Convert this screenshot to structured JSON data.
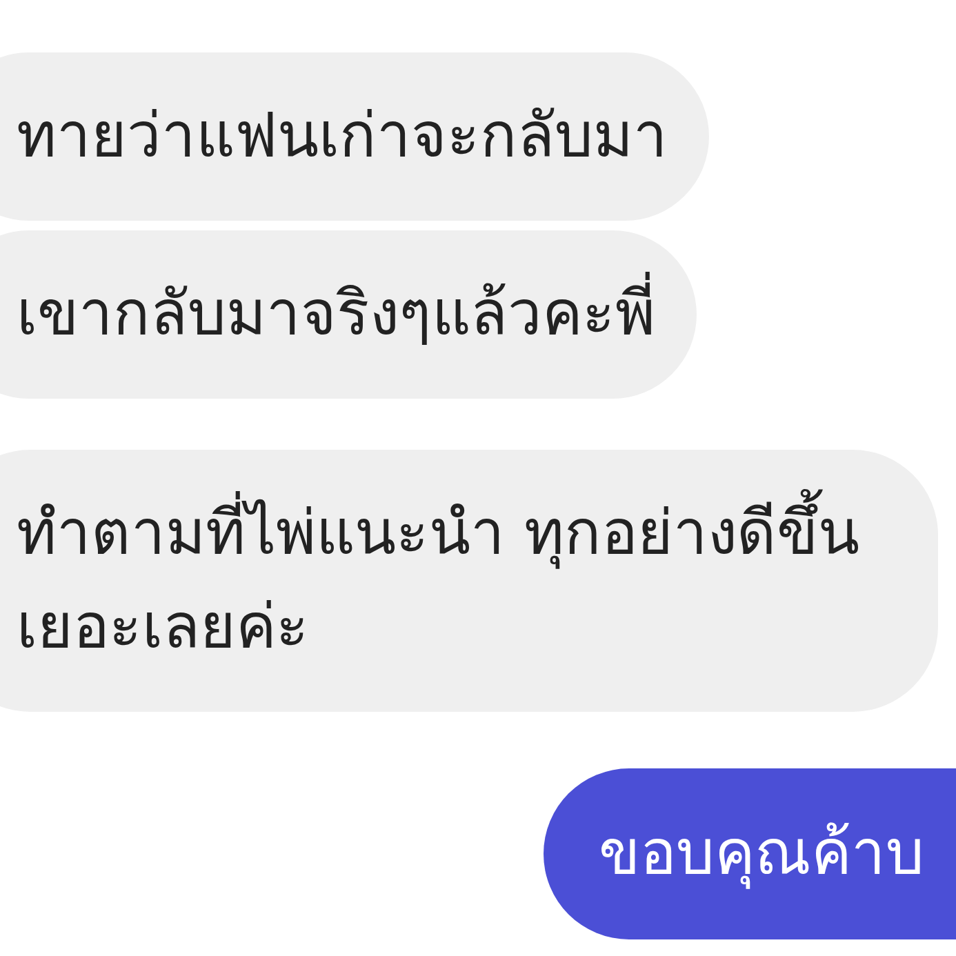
{
  "messages": [
    {
      "kind": "received",
      "text": "ทายว่าแฟนเก่าจะกลับมา"
    },
    {
      "kind": "received",
      "text": "เขากลับมาจริงๆแล้วคะพี่"
    },
    {
      "kind": "received",
      "text": "ทำตามที่ไพ่แนะนำ ทุกอย่างดีขึ้นเยอะเลยค่ะ"
    },
    {
      "kind": "sent",
      "text": "ขอบคุณค้าบ"
    }
  ]
}
